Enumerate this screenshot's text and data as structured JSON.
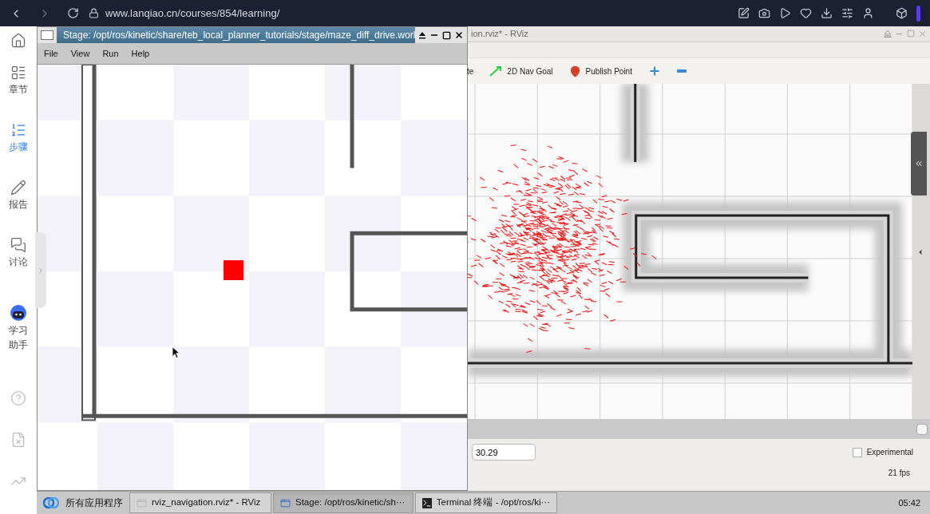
{
  "browser": {
    "url": "www.lanqiao.cn/courses/854/learning/"
  },
  "sidebar": {
    "items": [
      {
        "kind": "home",
        "selected": false
      },
      {
        "kind": "chapters",
        "label": "章节",
        "selected": false
      },
      {
        "kind": "steps",
        "label": "步骤",
        "selected": true
      },
      {
        "kind": "report",
        "label": "报告",
        "selected": false
      },
      {
        "kind": "discuss",
        "label": "讨论",
        "selected": false
      },
      {
        "kind": "assistant",
        "label": "学习助手",
        "selected": false
      },
      {
        "kind": "help",
        "selected": false
      },
      {
        "kind": "document",
        "selected": false
      },
      {
        "kind": "stats",
        "selected": false
      }
    ]
  },
  "stage_window": {
    "title": "Stage: /opt/ros/kinetic/share/teb_local_planner_tutorials/stage/maze_diff_drive.worl",
    "menu": [
      "File",
      "View",
      "Run",
      "Help"
    ]
  },
  "rviz_window": {
    "title": "ion.rviz* - RViz",
    "tools": [
      {
        "kind": "partial",
        "label": "te"
      },
      {
        "kind": "nav-goal",
        "label": "2D Nav Goal"
      },
      {
        "kind": "publish-point",
        "label": "Publish Point"
      },
      {
        "kind": "add"
      },
      {
        "kind": "remove"
      }
    ],
    "time_value": "30.29",
    "experimental": {
      "label": "Experimental",
      "checked": false
    },
    "fps": "21 fps"
  },
  "taskbar": {
    "start": "所有应用程序",
    "items": [
      {
        "kind": "rviz",
        "label": "rviz_navigation.rviz* - RViz",
        "selected": false
      },
      {
        "kind": "window",
        "label": "Stage: /opt/ros/kinetic/sh···",
        "selected": true
      },
      {
        "kind": "terminal",
        "label": "Terminal 终端 - /opt/ros/ki···",
        "selected": false
      }
    ],
    "clock": "05:42"
  }
}
